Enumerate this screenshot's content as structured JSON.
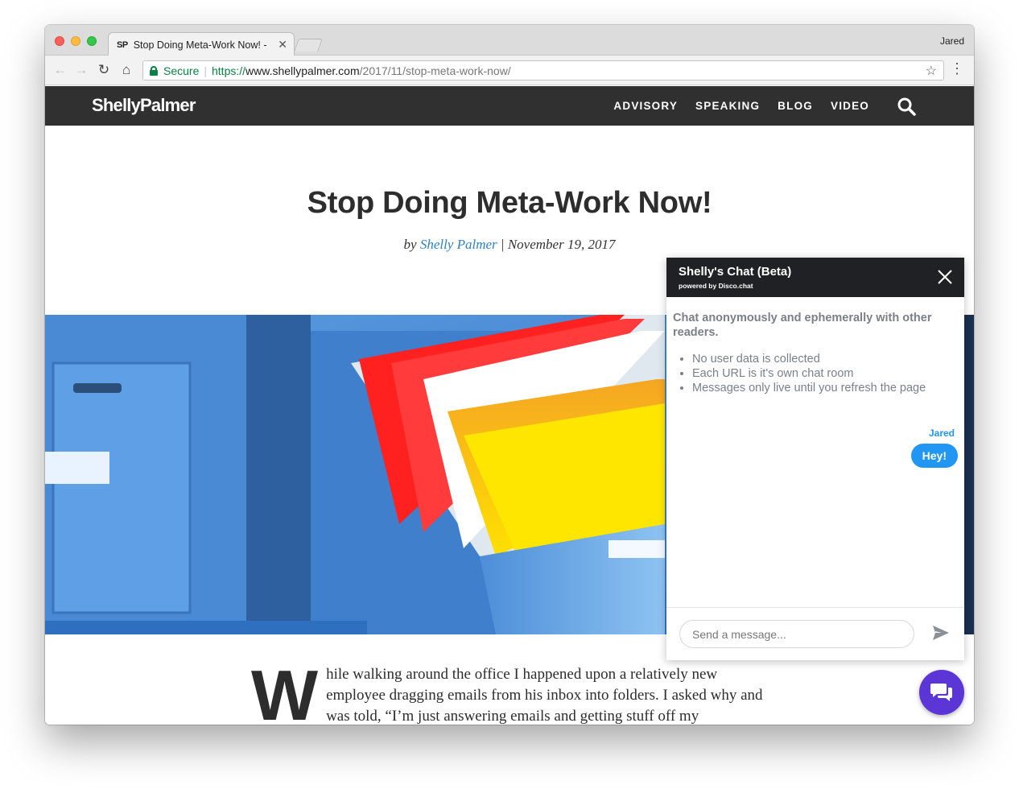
{
  "browser": {
    "tab_favicon": "SP",
    "tab_title": "Stop Doing Meta-Work Now! -",
    "profile_name": "Jared",
    "secure_label": "Secure",
    "url_scheme": "https://",
    "url_host": "www.shellypalmer.com",
    "url_path": "/2017/11/stop-meta-work-now/",
    "icons": [
      "back-icon",
      "forward-icon",
      "reload-icon",
      "home-icon",
      "star-icon",
      "menu-icon"
    ]
  },
  "site": {
    "logo": "ShellyPalmer",
    "nav": [
      "ADVISORY",
      "SPEAKING",
      "BLOG",
      "VIDEO"
    ],
    "header_color": "#303030"
  },
  "article": {
    "title": "Stop Doing Meta-Work Now!",
    "by": "by",
    "author": "Shelly Palmer",
    "date_sep": " | ",
    "date": "November 19, 2017",
    "dropcap": "W",
    "lead": "hile walking around the office I happened upon a relatively new employee dragging emails from his inbox into folders. I asked why and was told, “I’m just answering emails and getting stuff off my"
  },
  "chat": {
    "title": "Shelly's Chat (Beta)",
    "subtitle": "powered by Disco.chat",
    "intro": "Chat anonymously and ephemerally with other readers.",
    "features": [
      "No user data is collected",
      "Each URL is it's own chat room",
      "Messages only live until you refresh the page"
    ],
    "messages": [
      {
        "sender": "Jared",
        "text": "Hey!"
      }
    ],
    "input_placeholder": "Send a message...",
    "accent": "#2196f3",
    "fab_color": "#5b35d6"
  }
}
